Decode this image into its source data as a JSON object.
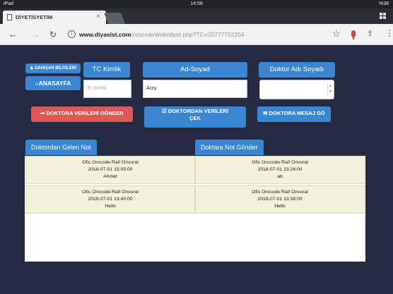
{
  "status_bar": {
    "device": "iPad",
    "time": "14:58",
    "battery": "%38"
  },
  "browser": {
    "tab_title": "DİYETİSYETİM",
    "url_host": "www.diyasist.com",
    "url_path": "/orocodeWeb/diyet.php?TC=20777752254"
  },
  "page": {
    "danisan_button": "DANIŞAN BİLGİLERİ",
    "anasayfa_button": "ANASAYFA",
    "tc_label": "TC Kimlik",
    "tc_placeholder": "Tc Kimlik",
    "adsoyad_label": "Ad-Soyad",
    "adsoyad_value": "Arzu",
    "doktor_label": "Doktor Adı Soyadı",
    "doktor_selected": "",
    "send_button": "DOKTORA VERİLERİ GÖNDER",
    "fetch_button_line1": "DOKTORDAN VERİLERİ",
    "fetch_button_line2": "ÇEK",
    "message_button": "DOKTORA MESAJ GÖ",
    "incoming_tab": "Doktordan Gelen Not",
    "outgoing_tab": "Doktara Not Gönder",
    "notes_left": [
      {
        "office": "Ofis Orocode:Raif Onvural",
        "datetime": "2018-07-01 15:05:00",
        "text": "Ahmet"
      },
      {
        "office": "Ofis Orocode:Raif Onvural",
        "datetime": "2018-07-01 13:40:00",
        "text": "Hello"
      }
    ],
    "notes_right": [
      {
        "office": "Ofis Orocode:Raif Onvural",
        "datetime": "2018-07-01 23:26:00",
        "text": "ab"
      },
      {
        "office": "Ofis Orocode:Raif Onvural",
        "datetime": "2018-07-01 13:38:00",
        "text": "Hello"
      }
    ]
  }
}
